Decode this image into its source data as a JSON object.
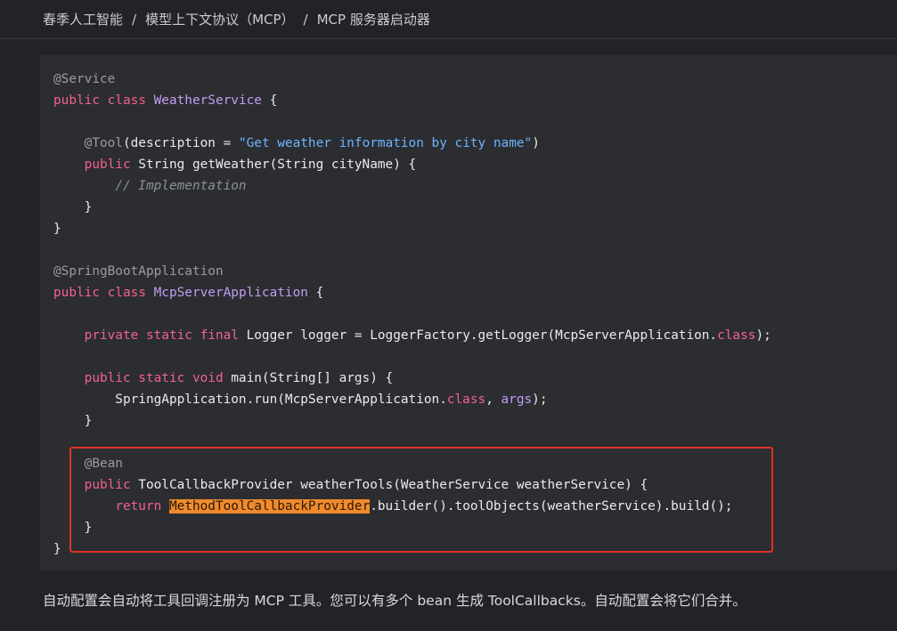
{
  "breadcrumb": {
    "items": [
      "春季人工智能",
      "模型上下文协议（MCP）",
      "MCP 服务器启动器"
    ],
    "separator": "/"
  },
  "code": {
    "lines": [
      [
        {
          "t": "@Service",
          "c": "ann"
        }
      ],
      [
        {
          "t": "public class ",
          "c": "kw"
        },
        {
          "t": "WeatherService",
          "c": "cls"
        },
        {
          "t": " {",
          "c": "plain"
        }
      ],
      [],
      [
        {
          "t": "    ",
          "c": "plain"
        },
        {
          "t": "@Tool",
          "c": "ann"
        },
        {
          "t": "(description = ",
          "c": "plain"
        },
        {
          "t": "\"Get weather information by city name\"",
          "c": "str"
        },
        {
          "t": ")",
          "c": "plain"
        }
      ],
      [
        {
          "t": "    ",
          "c": "plain"
        },
        {
          "t": "public",
          "c": "kw"
        },
        {
          "t": " String getWeather(String cityName) {",
          "c": "plain"
        }
      ],
      [
        {
          "t": "        ",
          "c": "plain"
        },
        {
          "t": "// Implementation",
          "c": "cmt"
        }
      ],
      [
        {
          "t": "    }",
          "c": "plain"
        }
      ],
      [
        {
          "t": "}",
          "c": "plain"
        }
      ],
      [],
      [
        {
          "t": "@SpringBootApplication",
          "c": "ann"
        }
      ],
      [
        {
          "t": "public class ",
          "c": "kw"
        },
        {
          "t": "McpServerApplication",
          "c": "cls"
        },
        {
          "t": " {",
          "c": "plain"
        }
      ],
      [],
      [
        {
          "t": "    ",
          "c": "plain"
        },
        {
          "t": "private static final",
          "c": "kw"
        },
        {
          "t": " Logger logger = LoggerFactory.getLogger(McpServerApplication.",
          "c": "plain"
        },
        {
          "t": "class",
          "c": "kw"
        },
        {
          "t": ");",
          "c": "plain"
        }
      ],
      [],
      [
        {
          "t": "    ",
          "c": "plain"
        },
        {
          "t": "public static void",
          "c": "kw"
        },
        {
          "t": " main(String[] args) {",
          "c": "plain"
        }
      ],
      [
        {
          "t": "        SpringApplication.run(McpServerApplication.",
          "c": "plain"
        },
        {
          "t": "class",
          "c": "kw"
        },
        {
          "t": ", ",
          "c": "plain"
        },
        {
          "t": "args",
          "c": "cls"
        },
        {
          "t": ");",
          "c": "plain"
        }
      ],
      [
        {
          "t": "    }",
          "c": "plain"
        }
      ],
      [],
      [
        {
          "t": "    ",
          "c": "plain"
        },
        {
          "t": "@Bean",
          "c": "ann"
        }
      ],
      [
        {
          "t": "    ",
          "c": "plain"
        },
        {
          "t": "public",
          "c": "kw"
        },
        {
          "t": " ToolCallbackProvider weatherTools(WeatherService weatherService) {",
          "c": "plain"
        }
      ],
      [
        {
          "t": "        ",
          "c": "plain"
        },
        {
          "t": "return",
          "c": "kw"
        },
        {
          "t": " ",
          "c": "plain"
        },
        {
          "t": "MethodToolCallbackProvider",
          "c": "hl"
        },
        {
          "t": ".builder().toolObjects(weatherService).build();",
          "c": "plain"
        }
      ],
      [
        {
          "t": "    }",
          "c": "plain"
        }
      ],
      [
        {
          "t": "}",
          "c": "plain"
        }
      ]
    ]
  },
  "paragraph": "自动配置会自动将工具回调注册为 MCP 工具。您可以有多个 bean 生成 ToolCallbacks。自动配置会将它们合并。"
}
